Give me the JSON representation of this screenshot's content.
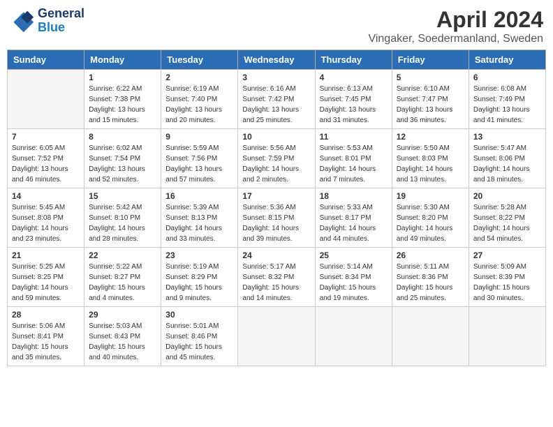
{
  "header": {
    "logo_line1": "General",
    "logo_line2": "Blue",
    "title": "April 2024",
    "subtitle": "Vingaker, Soedermanland, Sweden"
  },
  "weekdays": [
    "Sunday",
    "Monday",
    "Tuesday",
    "Wednesday",
    "Thursday",
    "Friday",
    "Saturday"
  ],
  "weeks": [
    [
      {
        "day": "",
        "sunrise": "",
        "sunset": "",
        "daylight": ""
      },
      {
        "day": "1",
        "sunrise": "Sunrise: 6:22 AM",
        "sunset": "Sunset: 7:38 PM",
        "daylight": "Daylight: 13 hours and 15 minutes."
      },
      {
        "day": "2",
        "sunrise": "Sunrise: 6:19 AM",
        "sunset": "Sunset: 7:40 PM",
        "daylight": "Daylight: 13 hours and 20 minutes."
      },
      {
        "day": "3",
        "sunrise": "Sunrise: 6:16 AM",
        "sunset": "Sunset: 7:42 PM",
        "daylight": "Daylight: 13 hours and 25 minutes."
      },
      {
        "day": "4",
        "sunrise": "Sunrise: 6:13 AM",
        "sunset": "Sunset: 7:45 PM",
        "daylight": "Daylight: 13 hours and 31 minutes."
      },
      {
        "day": "5",
        "sunrise": "Sunrise: 6:10 AM",
        "sunset": "Sunset: 7:47 PM",
        "daylight": "Daylight: 13 hours and 36 minutes."
      },
      {
        "day": "6",
        "sunrise": "Sunrise: 6:08 AM",
        "sunset": "Sunset: 7:49 PM",
        "daylight": "Daylight: 13 hours and 41 minutes."
      }
    ],
    [
      {
        "day": "7",
        "sunrise": "Sunrise: 6:05 AM",
        "sunset": "Sunset: 7:52 PM",
        "daylight": "Daylight: 13 hours and 46 minutes."
      },
      {
        "day": "8",
        "sunrise": "Sunrise: 6:02 AM",
        "sunset": "Sunset: 7:54 PM",
        "daylight": "Daylight: 13 hours and 52 minutes."
      },
      {
        "day": "9",
        "sunrise": "Sunrise: 5:59 AM",
        "sunset": "Sunset: 7:56 PM",
        "daylight": "Daylight: 13 hours and 57 minutes."
      },
      {
        "day": "10",
        "sunrise": "Sunrise: 5:56 AM",
        "sunset": "Sunset: 7:59 PM",
        "daylight": "Daylight: 14 hours and 2 minutes."
      },
      {
        "day": "11",
        "sunrise": "Sunrise: 5:53 AM",
        "sunset": "Sunset: 8:01 PM",
        "daylight": "Daylight: 14 hours and 7 minutes."
      },
      {
        "day": "12",
        "sunrise": "Sunrise: 5:50 AM",
        "sunset": "Sunset: 8:03 PM",
        "daylight": "Daylight: 14 hours and 13 minutes."
      },
      {
        "day": "13",
        "sunrise": "Sunrise: 5:47 AM",
        "sunset": "Sunset: 8:06 PM",
        "daylight": "Daylight: 14 hours and 18 minutes."
      }
    ],
    [
      {
        "day": "14",
        "sunrise": "Sunrise: 5:45 AM",
        "sunset": "Sunset: 8:08 PM",
        "daylight": "Daylight: 14 hours and 23 minutes."
      },
      {
        "day": "15",
        "sunrise": "Sunrise: 5:42 AM",
        "sunset": "Sunset: 8:10 PM",
        "daylight": "Daylight: 14 hours and 28 minutes."
      },
      {
        "day": "16",
        "sunrise": "Sunrise: 5:39 AM",
        "sunset": "Sunset: 8:13 PM",
        "daylight": "Daylight: 14 hours and 33 minutes."
      },
      {
        "day": "17",
        "sunrise": "Sunrise: 5:36 AM",
        "sunset": "Sunset: 8:15 PM",
        "daylight": "Daylight: 14 hours and 39 minutes."
      },
      {
        "day": "18",
        "sunrise": "Sunrise: 5:33 AM",
        "sunset": "Sunset: 8:17 PM",
        "daylight": "Daylight: 14 hours and 44 minutes."
      },
      {
        "day": "19",
        "sunrise": "Sunrise: 5:30 AM",
        "sunset": "Sunset: 8:20 PM",
        "daylight": "Daylight: 14 hours and 49 minutes."
      },
      {
        "day": "20",
        "sunrise": "Sunrise: 5:28 AM",
        "sunset": "Sunset: 8:22 PM",
        "daylight": "Daylight: 14 hours and 54 minutes."
      }
    ],
    [
      {
        "day": "21",
        "sunrise": "Sunrise: 5:25 AM",
        "sunset": "Sunset: 8:25 PM",
        "daylight": "Daylight: 14 hours and 59 minutes."
      },
      {
        "day": "22",
        "sunrise": "Sunrise: 5:22 AM",
        "sunset": "Sunset: 8:27 PM",
        "daylight": "Daylight: 15 hours and 4 minutes."
      },
      {
        "day": "23",
        "sunrise": "Sunrise: 5:19 AM",
        "sunset": "Sunset: 8:29 PM",
        "daylight": "Daylight: 15 hours and 9 minutes."
      },
      {
        "day": "24",
        "sunrise": "Sunrise: 5:17 AM",
        "sunset": "Sunset: 8:32 PM",
        "daylight": "Daylight: 15 hours and 14 minutes."
      },
      {
        "day": "25",
        "sunrise": "Sunrise: 5:14 AM",
        "sunset": "Sunset: 8:34 PM",
        "daylight": "Daylight: 15 hours and 19 minutes."
      },
      {
        "day": "26",
        "sunrise": "Sunrise: 5:11 AM",
        "sunset": "Sunset: 8:36 PM",
        "daylight": "Daylight: 15 hours and 25 minutes."
      },
      {
        "day": "27",
        "sunrise": "Sunrise: 5:09 AM",
        "sunset": "Sunset: 8:39 PM",
        "daylight": "Daylight: 15 hours and 30 minutes."
      }
    ],
    [
      {
        "day": "28",
        "sunrise": "Sunrise: 5:06 AM",
        "sunset": "Sunset: 8:41 PM",
        "daylight": "Daylight: 15 hours and 35 minutes."
      },
      {
        "day": "29",
        "sunrise": "Sunrise: 5:03 AM",
        "sunset": "Sunset: 8:43 PM",
        "daylight": "Daylight: 15 hours and 40 minutes."
      },
      {
        "day": "30",
        "sunrise": "Sunrise: 5:01 AM",
        "sunset": "Sunset: 8:46 PM",
        "daylight": "Daylight: 15 hours and 45 minutes."
      },
      {
        "day": "",
        "sunrise": "",
        "sunset": "",
        "daylight": ""
      },
      {
        "day": "",
        "sunrise": "",
        "sunset": "",
        "daylight": ""
      },
      {
        "day": "",
        "sunrise": "",
        "sunset": "",
        "daylight": ""
      },
      {
        "day": "",
        "sunrise": "",
        "sunset": "",
        "daylight": ""
      }
    ]
  ]
}
